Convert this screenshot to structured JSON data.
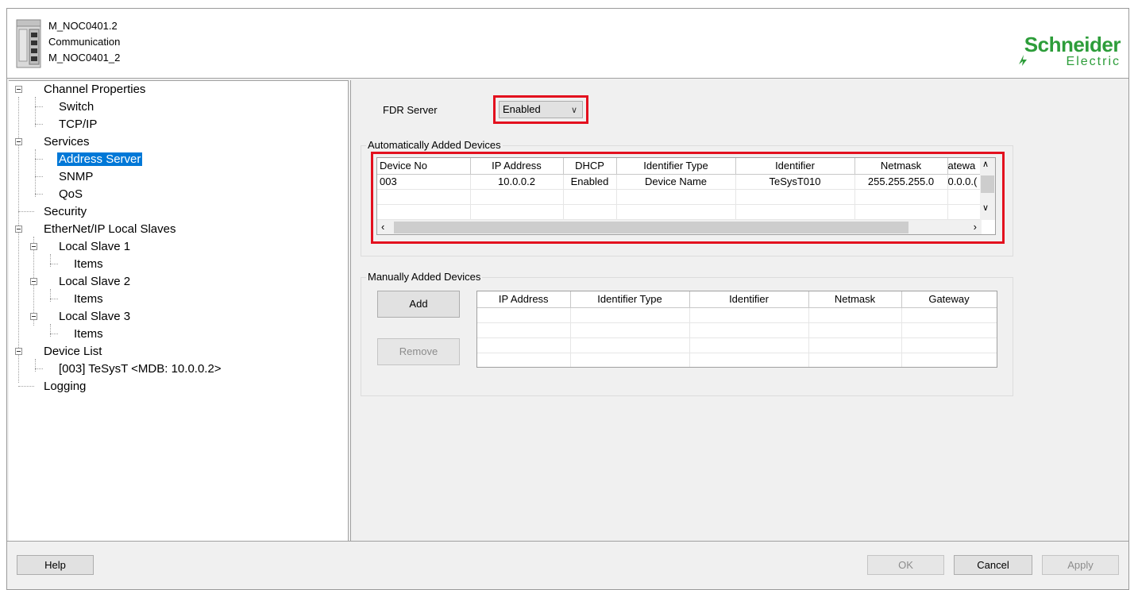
{
  "header": {
    "line1": "M_NOC0401.2",
    "line2": "Communication",
    "line3": "M_NOC0401_2",
    "logo_top": "Schneider",
    "logo_bottom": "Electric",
    "brand_color": "#2d9d3a"
  },
  "tree": {
    "items": [
      {
        "label": "Channel Properties"
      },
      {
        "label": "Switch"
      },
      {
        "label": "TCP/IP"
      },
      {
        "label": "Services"
      },
      {
        "label": "Address Server",
        "selected": true
      },
      {
        "label": "SNMP"
      },
      {
        "label": "QoS"
      },
      {
        "label": "Security"
      },
      {
        "label": "EtherNet/IP Local Slaves"
      },
      {
        "label": "Local Slave 1"
      },
      {
        "label": "Items"
      },
      {
        "label": "Local Slave 2"
      },
      {
        "label": "Items"
      },
      {
        "label": "Local Slave 3"
      },
      {
        "label": "Items"
      },
      {
        "label": "Device List"
      },
      {
        "label": "[003] TeSysT <MDB: 10.0.0.2>"
      },
      {
        "label": "Logging"
      }
    ]
  },
  "fdr": {
    "label": "FDR Server",
    "value": "Enabled"
  },
  "auto_devices": {
    "title": "Automatically Added Devices",
    "columns": [
      "Device No",
      "IP Address",
      "DHCP",
      "Identifier Type",
      "Identifier",
      "Netmask",
      "atewa"
    ],
    "rows": [
      [
        "003",
        "10.0.0.2",
        "Enabled",
        "Device Name",
        "TeSysT010",
        "255.255.255.0",
        "0.0.0.("
      ],
      [
        "",
        "",
        "",
        "",
        "",
        "",
        ""
      ],
      [
        "",
        "",
        "",
        "",
        "",
        "",
        ""
      ]
    ]
  },
  "manual_devices": {
    "title": "Manually Added Devices",
    "add_label": "Add",
    "remove_label": "Remove",
    "columns": [
      "IP Address",
      "Identifier Type",
      "Identifier",
      "Netmask",
      "Gateway"
    ],
    "rows": [
      [
        "",
        "",
        "",
        "",
        ""
      ],
      [
        "",
        "",
        "",
        "",
        ""
      ],
      [
        "",
        "",
        "",
        "",
        ""
      ],
      [
        "",
        "",
        "",
        "",
        ""
      ]
    ]
  },
  "footer": {
    "help": "Help",
    "ok": "OK",
    "cancel": "Cancel",
    "apply": "Apply"
  },
  "highlight_color": "#e3101e"
}
